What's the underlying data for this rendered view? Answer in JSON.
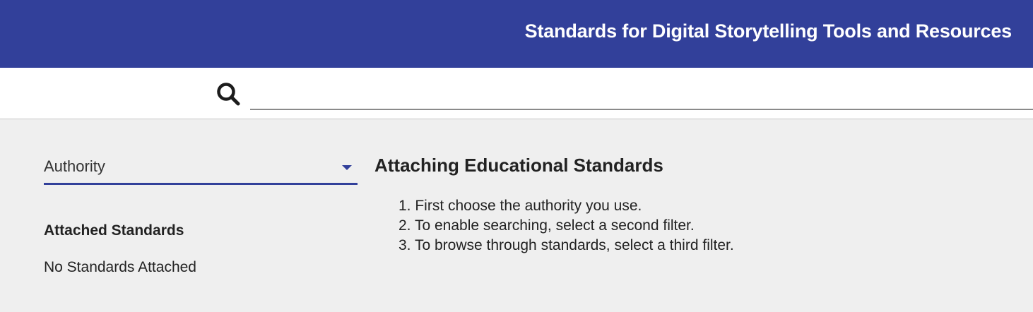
{
  "header": {
    "title": "Standards for Digital Storytelling Tools and Resources",
    "background_color": "#32409a"
  },
  "search": {
    "icon": "search-icon",
    "value": "",
    "placeholder": ""
  },
  "filter": {
    "selected": "Authority",
    "icon": "chevron-down-icon",
    "accent_color": "#32409a"
  },
  "attached": {
    "heading": "Attached Standards",
    "empty_text": "No Standards Attached"
  },
  "info": {
    "heading": "Attaching Educational Standards",
    "steps": [
      "1. First choose the authority you use.",
      "2. To enable searching, select a second filter.",
      "3. To browse through standards, select a third filter."
    ]
  }
}
